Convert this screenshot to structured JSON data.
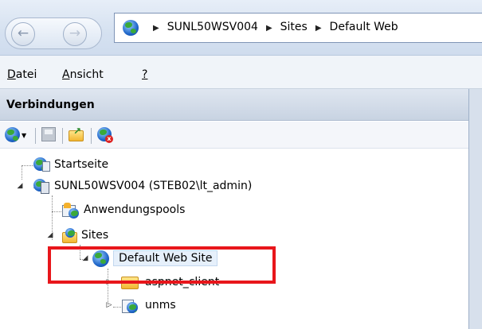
{
  "address_bar": {
    "back_symbol": "←",
    "forward_symbol": "→",
    "breadcrumbs": [
      "SUNL50WSV004",
      "Sites",
      "Default Web"
    ]
  },
  "menu": {
    "items": [
      {
        "label": "Datei",
        "access_key": "D"
      },
      {
        "label": "Ansicht",
        "access_key": "A"
      },
      {
        "label": "?",
        "access_key": "?"
      }
    ]
  },
  "connections_panel": {
    "title": "Verbindungen",
    "toolbar_icons": [
      "connect-globe-dropdown-icon",
      "save-icon",
      "up-folder-icon",
      "disconnect-icon"
    ]
  },
  "tree": [
    {
      "label": "Startseite",
      "icon": "start-page-icon",
      "level": 0,
      "expander": ""
    },
    {
      "label": "SUNL50WSV004 (STEB02\\lt_admin)",
      "icon": "server-icon",
      "level": 0,
      "expander": "◢"
    },
    {
      "label": "Anwendungspools",
      "icon": "app-pools-icon",
      "level": 1,
      "expander": ""
    },
    {
      "label": "Sites",
      "icon": "sites-folder-icon",
      "level": 1,
      "expander": "◢"
    },
    {
      "label": "Default Web Site",
      "icon": "globe-icon",
      "level": 2,
      "expander": "◢",
      "selected": true
    },
    {
      "label": "aspnet_client",
      "icon": "folder-icon",
      "level": 3,
      "expander": "▷"
    },
    {
      "label": "unms",
      "icon": "application-globe-icon",
      "level": 3,
      "expander": "▷"
    }
  ],
  "colors": {
    "highlight_box": "#e8161b",
    "panel_header": "#c8d3e2"
  }
}
